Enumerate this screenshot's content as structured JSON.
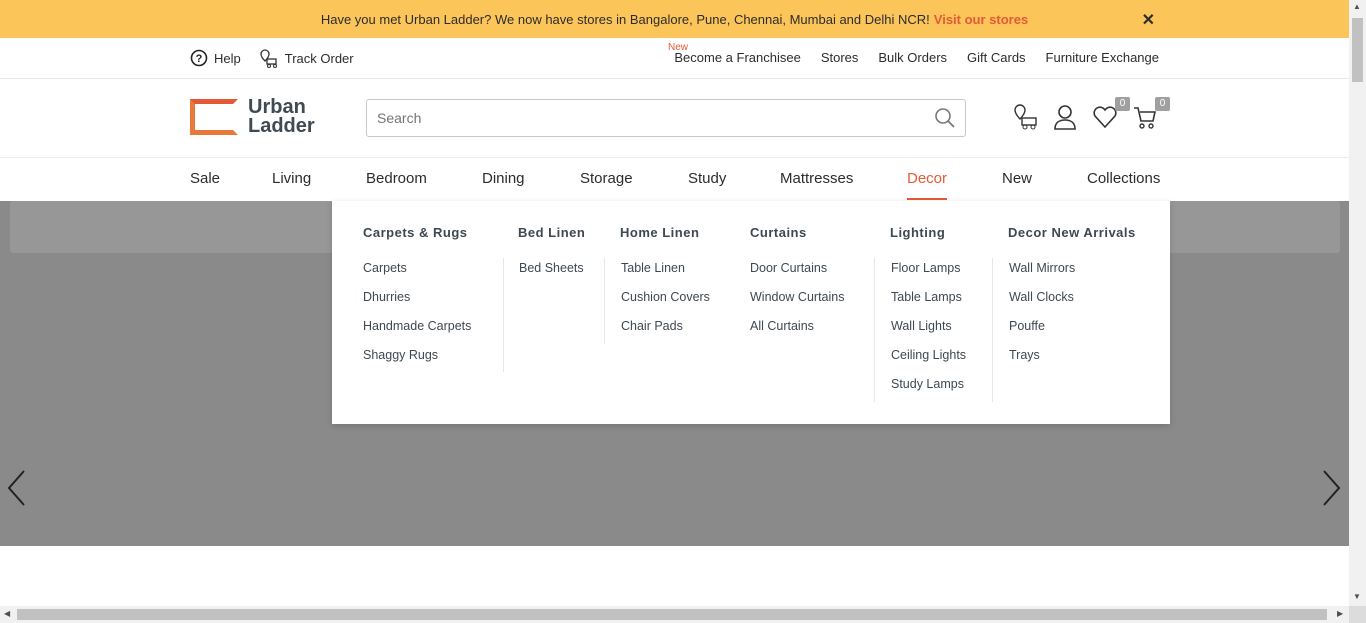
{
  "announcement": {
    "text": "Have you met Urban Ladder? We now have stores in Bangalore, Pune, Chennai, Mumbai and Delhi NCR!",
    "link": "Visit our stores",
    "close": "✕"
  },
  "utility": {
    "help": "Help",
    "track_order": "Track Order",
    "new_tag": "New",
    "links": [
      "Become a Franchisee",
      "Stores",
      "Bulk Orders",
      "Gift Cards",
      "Furniture Exchange"
    ]
  },
  "header": {
    "logo_line1": "Urban",
    "logo_line2": "Ladder",
    "search_placeholder": "Search",
    "wishlist_count": "0",
    "cart_count": "0"
  },
  "nav": {
    "items": [
      "Sale",
      "Living",
      "Bedroom",
      "Dining",
      "Storage",
      "Study",
      "Mattresses",
      "Decor",
      "New",
      "Collections"
    ],
    "active": "Decor"
  },
  "mega": {
    "columns": [
      {
        "heading": "Carpets & Rugs",
        "links": [
          "Carpets",
          "Dhurries",
          "Handmade Carpets",
          "Shaggy Rugs"
        ]
      },
      {
        "heading": "Bed Linen",
        "links": [
          "Bed Sheets"
        ]
      },
      {
        "heading": "Home Linen",
        "links": [
          "Table Linen",
          "Cushion Covers",
          "Chair Pads"
        ]
      },
      {
        "heading": "Curtains",
        "links": [
          "Door Curtains",
          "Window Curtains",
          "All Curtains"
        ]
      },
      {
        "heading": "Lighting",
        "links": [
          "Floor Lamps",
          "Table Lamps",
          "Wall Lights",
          "Ceiling Lights",
          "Study Lamps"
        ]
      },
      {
        "heading": "Decor New Arrivals",
        "links": [
          "Wall Mirrors",
          "Wall Clocks",
          "Pouffe",
          "Trays"
        ]
      }
    ]
  },
  "colors": {
    "accent": "#e55a36",
    "banner": "#fcc55a"
  }
}
